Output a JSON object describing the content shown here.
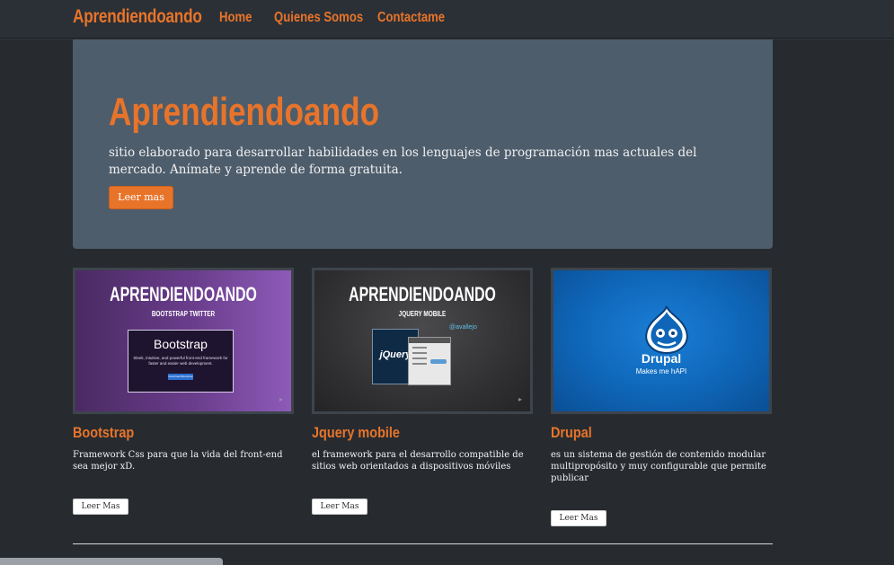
{
  "navbar": {
    "brand": "Aprendiendoando",
    "links": [
      "Home",
      "Quienes Somos",
      "Contactame"
    ]
  },
  "jumbotron": {
    "title": "Aprendiendoando",
    "text": "sitio elaborado para desarrollar habilidades en los lenguajes de programación mas actuales del mercado. Anímate y aprende de forma gratuita.",
    "button": "Leer mas"
  },
  "cards": [
    {
      "thumb_title": "APRENDIENDOANDO",
      "thumb_subtitle": "BOOTSTRAP TWITTER",
      "thumb_box_title": "Bootstrap",
      "thumb_box_text": "Sleek, intuitive, and powerful front-end framework for faster and easier web development.",
      "thumb_box_button": "Download Bootstrap",
      "title": "Bootstrap",
      "text": "Framework Css para que la vida del front-end sea mejor xD.",
      "button": "Leer Mas"
    },
    {
      "thumb_title": "APRENDIENDOANDO",
      "thumb_subtitle": "JQUERY MOBILE",
      "thumb_handle": "@avallejo",
      "thumb_logo": "jQuery",
      "title": "Jquery mobile",
      "text": "el framework para el desarrollo compatible de sitios web orientados a dispositivos móviles",
      "button": "Leer Mas"
    },
    {
      "thumb_logo": "Drupal",
      "thumb_tagline": "Makes me hAPI",
      "title": "Drupal",
      "text": "es un sistema de gestión de contenido modular multipropósito y muy configurable que permite publicar",
      "button": "Leer Mas"
    }
  ],
  "colors": {
    "accent": "#e8742a",
    "background": "#272b30",
    "jumbotron": "#4e5d6c"
  }
}
